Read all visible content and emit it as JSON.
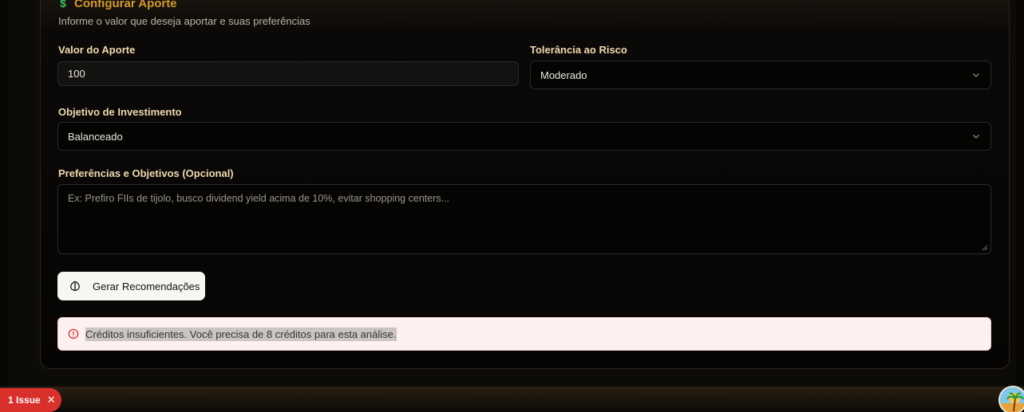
{
  "card": {
    "title": "Configurar Aporte",
    "title_icon": "dollar-icon",
    "subtitle": "Informe o valor que deseja aportar e suas preferências"
  },
  "form": {
    "valor_label": "Valor do Aporte",
    "valor_value": "100",
    "risco_label": "Tolerância ao Risco",
    "risco_value": "Moderado",
    "objetivo_label": "Objetivo de Investimento",
    "objetivo_value": "Balanceado",
    "preferencias_label": "Preferências e Objetivos (Opcional)",
    "preferencias_placeholder": "Ex: Prefiro FIIs de tijolo, busco dividend yield acima de 10%, evitar shopping centers..."
  },
  "button": {
    "label": "Gerar Recomendações",
    "icon": "brain-icon"
  },
  "alert": {
    "message": "Créditos insuficientes. Você precisa de 8 créditos para esta análise.",
    "icon": "alert-circle-icon"
  },
  "issues": {
    "label": "1 Issue",
    "close": "✕"
  },
  "colors": {
    "accent": "#d49a2a",
    "label": "#f0d9b0",
    "alert_bg": "#fdf0ef",
    "alert_icon": "#d9302c",
    "issue_badge": "#d9302c"
  }
}
